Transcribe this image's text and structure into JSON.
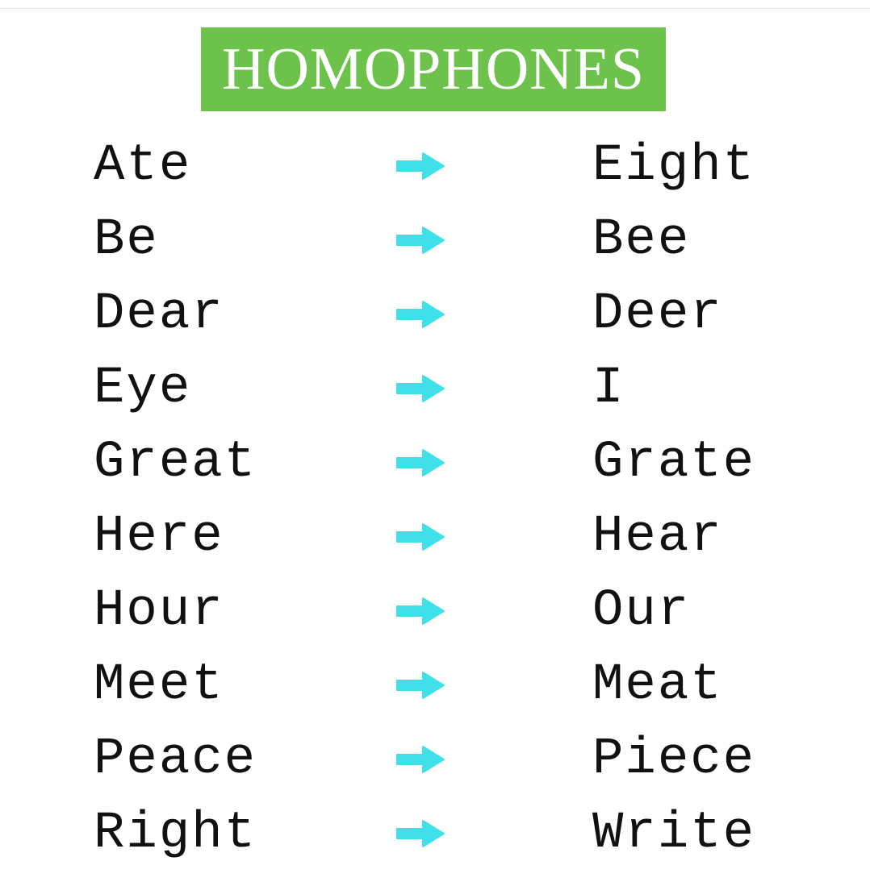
{
  "title": "HOMOPHONES",
  "colors": {
    "banner": "#6cc24a",
    "arrow": "#3fe0ea",
    "text": "#111111"
  },
  "arrow_icon": "right-arrow-icon",
  "pairs": [
    {
      "left": "Ate",
      "right": "Eight"
    },
    {
      "left": "Be",
      "right": "Bee"
    },
    {
      "left": "Dear",
      "right": "Deer"
    },
    {
      "left": "Eye",
      "right": "I"
    },
    {
      "left": "Great",
      "right": "Grate"
    },
    {
      "left": "Here",
      "right": "Hear"
    },
    {
      "left": "Hour",
      "right": "Our"
    },
    {
      "left": "Meet",
      "right": "Meat"
    },
    {
      "left": "Peace",
      "right": "Piece"
    },
    {
      "left": "Right",
      "right": "Write"
    }
  ]
}
